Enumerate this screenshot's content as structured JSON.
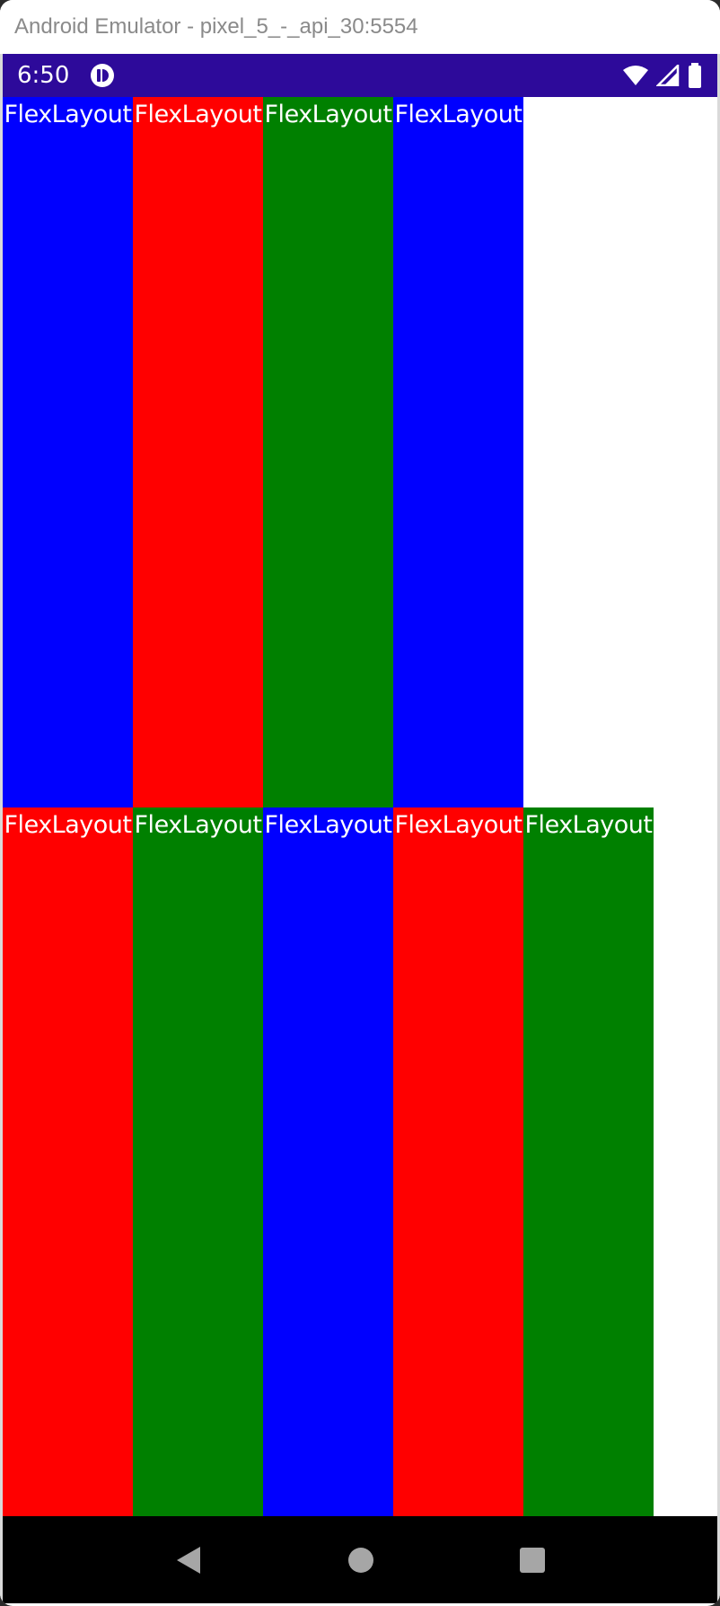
{
  "window": {
    "title": "Android Emulator - pixel_5_-_api_30:5554"
  },
  "status_bar": {
    "time": "6:50",
    "background": "#2d0a9a",
    "icons": [
      "app-notification-icon",
      "wifi-icon",
      "cell-signal-icon",
      "battery-icon"
    ]
  },
  "rows": [
    {
      "items": [
        {
          "label": "FlexLayout",
          "color": "#0000ff"
        },
        {
          "label": "FlexLayout",
          "color": "#ff0000"
        },
        {
          "label": "FlexLayout",
          "color": "#008000"
        },
        {
          "label": "FlexLayout",
          "color": "#0000ff"
        }
      ]
    },
    {
      "items": [
        {
          "label": "FlexLayout",
          "color": "#ff0000"
        },
        {
          "label": "FlexLayout",
          "color": "#008000"
        },
        {
          "label": "FlexLayout",
          "color": "#0000ff"
        },
        {
          "label": "FlexLayout",
          "color": "#ff0000"
        },
        {
          "label": "FlexLayout",
          "color": "#008000"
        }
      ]
    }
  ],
  "nav_bar": {
    "background": "#000000",
    "buttons": [
      "back-icon",
      "home-icon",
      "recents-icon"
    ]
  }
}
